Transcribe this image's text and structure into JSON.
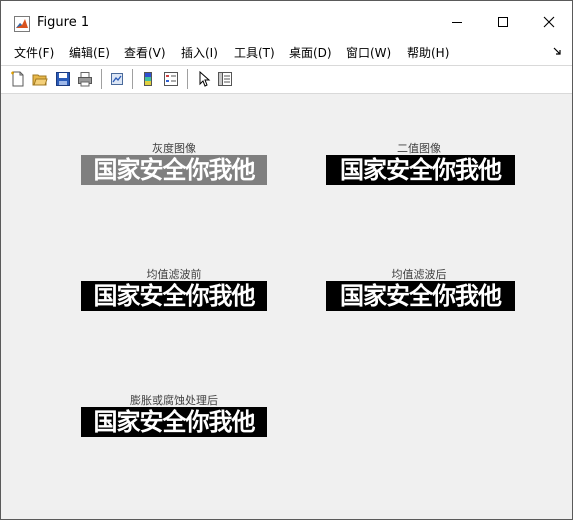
{
  "window": {
    "title": "Figure 1"
  },
  "menu": [
    "文件(F)",
    "编辑(E)",
    "查看(V)",
    "插入(I)",
    "工具(T)",
    "桌面(D)",
    "窗口(W)",
    "帮助(H)"
  ],
  "toolbar_icons": [
    "new-figure-icon",
    "open-folder-icon",
    "save-icon",
    "print-icon",
    "link-plot-icon",
    "colorbar-icon",
    "legend-icon",
    "pointer-icon",
    "property-inspector-icon"
  ],
  "axes": [
    {
      "title": "灰度图像",
      "image_text": "国家安全你我他",
      "bg": "#7f7f7f",
      "fg": "#ffffff"
    },
    {
      "title": "二值图像",
      "image_text": "国家安全你我他",
      "bg": "#000000",
      "fg": "#ffffff"
    },
    {
      "title": "均值滤波前",
      "image_text": "国家安全你我他",
      "bg": "#000000",
      "fg": "#ffffff"
    },
    {
      "title": "均值滤波后",
      "image_text": "国家安全你我他",
      "bg": "#000000",
      "fg": "#ffffff"
    },
    {
      "title": "膨胀或腐蚀处理后",
      "image_text": "国家安全你我他",
      "bg": "#000000",
      "fg": "#ffffff"
    }
  ],
  "colors": {
    "window_bg": "#f0f0f0",
    "titlebar_bg": "#ffffff",
    "matlab_orange": "#d9531e"
  }
}
